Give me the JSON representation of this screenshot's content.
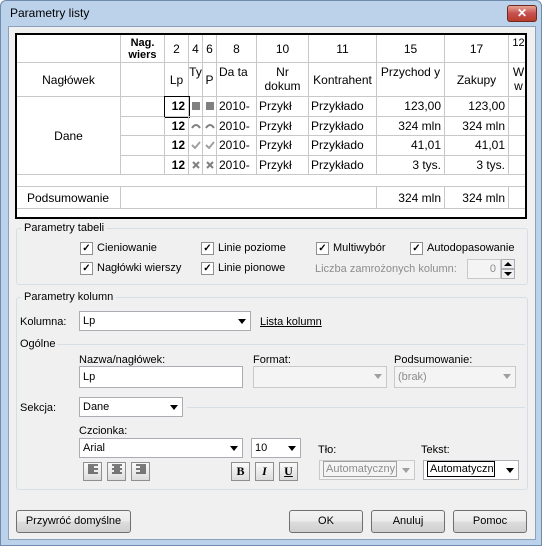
{
  "window": {
    "title": "Parametry listy",
    "close_glyph": "✕"
  },
  "preview": {
    "col_numbers": [
      "2",
      "4",
      "6",
      "8",
      "10",
      "11",
      "15",
      "17",
      "12"
    ],
    "corner_header": "Nag.\nwiers",
    "col_names": [
      "Lp",
      "Ty",
      "P",
      "Da ta",
      "Nr dokum",
      "Kontrahent",
      "Przychod y",
      "Zakupy",
      "W w"
    ],
    "row_labels": {
      "header": "Nagłówek",
      "data": "Dane",
      "summary": "Podsumowanie"
    },
    "rows": [
      [
        "12",
        "",
        "",
        "2010-",
        "Przykł",
        "Przykłado",
        "123,00",
        "123,00"
      ],
      [
        "12",
        "",
        "",
        "2010-",
        "Przykł",
        "Przykłado",
        "324 mln",
        "324 mln"
      ],
      [
        "12",
        "",
        "",
        "2010-",
        "Przykł",
        "Przykłado",
        "41,01",
        "41,01"
      ],
      [
        "12",
        "",
        "",
        "2010-",
        "Przykł",
        "Przykłado",
        "3 tys.",
        "3 tys."
      ]
    ],
    "summary_values": [
      "324 mln",
      "324 mln"
    ]
  },
  "table_params": {
    "legend": "Parametry tabeli",
    "shading": "Cieniowanie",
    "row_headers": "Nagłówki wierszy",
    "h_lines": "Linie poziome",
    "v_lines": "Linie pionowe",
    "multiselect": "Multiwybór",
    "autofit": "Autodopasowanie",
    "frozen_label": "Liczba zamrożonych kolumn:",
    "frozen_value": "0"
  },
  "column_params": {
    "legend": "Parametry kolumn",
    "column_label": "Kolumna:",
    "column_value": "Lp",
    "column_list_link": "Lista kolumn",
    "general": "Ogólne",
    "name_label": "Nazwa/nagłówek:",
    "name_value": "Lp",
    "format_label": "Format:",
    "format_value": "",
    "summary_label": "Podsumowanie:",
    "summary_value": "(brak)",
    "section_label": "Sekcja:",
    "section_value": "Dane",
    "font_label": "Czcionka:",
    "font_value": "Arial",
    "size_value": "10",
    "bg_label": "Tło:",
    "bg_value": "Automatyczny",
    "text_label": "Tekst:",
    "text_value": "Automatyczny",
    "bold": "B",
    "italic": "I",
    "underline": "U"
  },
  "buttons": {
    "reset": "Przywróć domyślne",
    "ok": "OK",
    "cancel": "Anuluj",
    "help": "Pomoc"
  }
}
